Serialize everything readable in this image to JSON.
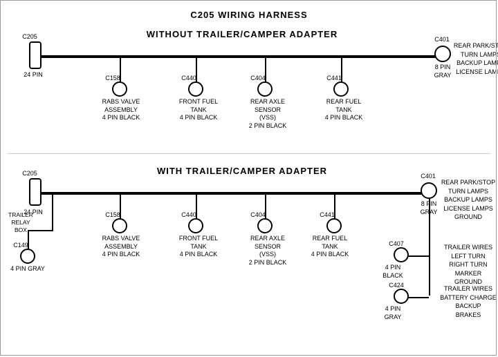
{
  "title": "C205 WIRING HARNESS",
  "section1": {
    "label": "WITHOUT  TRAILER/CAMPER  ADAPTER",
    "connectors": {
      "left": {
        "id": "C205",
        "pins": "24 PIN"
      },
      "right": {
        "id": "C401",
        "pins": "8 PIN\nGRAY",
        "label": "REAR PARK/STOP\nTURN LAMPS\nBACKUP LAMPS\nLICENSE LAMPS"
      },
      "c1": {
        "id": "C158",
        "label": "RABS VALVE\nASSEMBLY\n4 PIN BLACK"
      },
      "c2": {
        "id": "C440",
        "label": "FRONT FUEL\nTANK\n4 PIN BLACK"
      },
      "c3": {
        "id": "C404",
        "label": "REAR AXLE\nSENSOR\n(VSS)\n2 PIN BLACK"
      },
      "c4": {
        "id": "C441",
        "label": "REAR FUEL\nTANK\n4 PIN BLACK"
      }
    }
  },
  "section2": {
    "label": "WITH  TRAILER/CAMPER  ADAPTER",
    "connectors": {
      "left": {
        "id": "C205",
        "pins": "24 PIN"
      },
      "right": {
        "id": "C401",
        "pins": "8 PIN\nGRAY",
        "label": "REAR PARK/STOP\nTURN LAMPS\nBACKUP LAMPS\nLICENSE LAMPS\nGROUND"
      },
      "c1": {
        "id": "C158",
        "label": "RABS VALVE\nASSEMBLY\n4 PIN BLACK"
      },
      "c2": {
        "id": "C440",
        "label": "FRONT FUEL\nTANK\n4 PIN BLACK"
      },
      "c3": {
        "id": "C404",
        "label": "REAR AXLE\nSENSOR\n(VSS)\n2 PIN BLACK"
      },
      "c4": {
        "id": "C441",
        "label": "REAR FUEL\nTANK\n4 PIN BLACK"
      },
      "c149": {
        "id": "C149",
        "label": "4 PIN GRAY"
      },
      "trailer_relay": "TRAILER\nRELAY\nBOX",
      "c407": {
        "id": "C407",
        "pins": "4 PIN\nBLACK",
        "label": "TRAILER WIRES\nLEFT TURN\nRIGHT TURN\nMARKER\nGROUND"
      },
      "c424": {
        "id": "C424",
        "pins": "4 PIN\nGRAY",
        "label": "TRAILER WIRES\nBATTERY CHARGE\nBACKUP\nBRAKES"
      }
    }
  }
}
